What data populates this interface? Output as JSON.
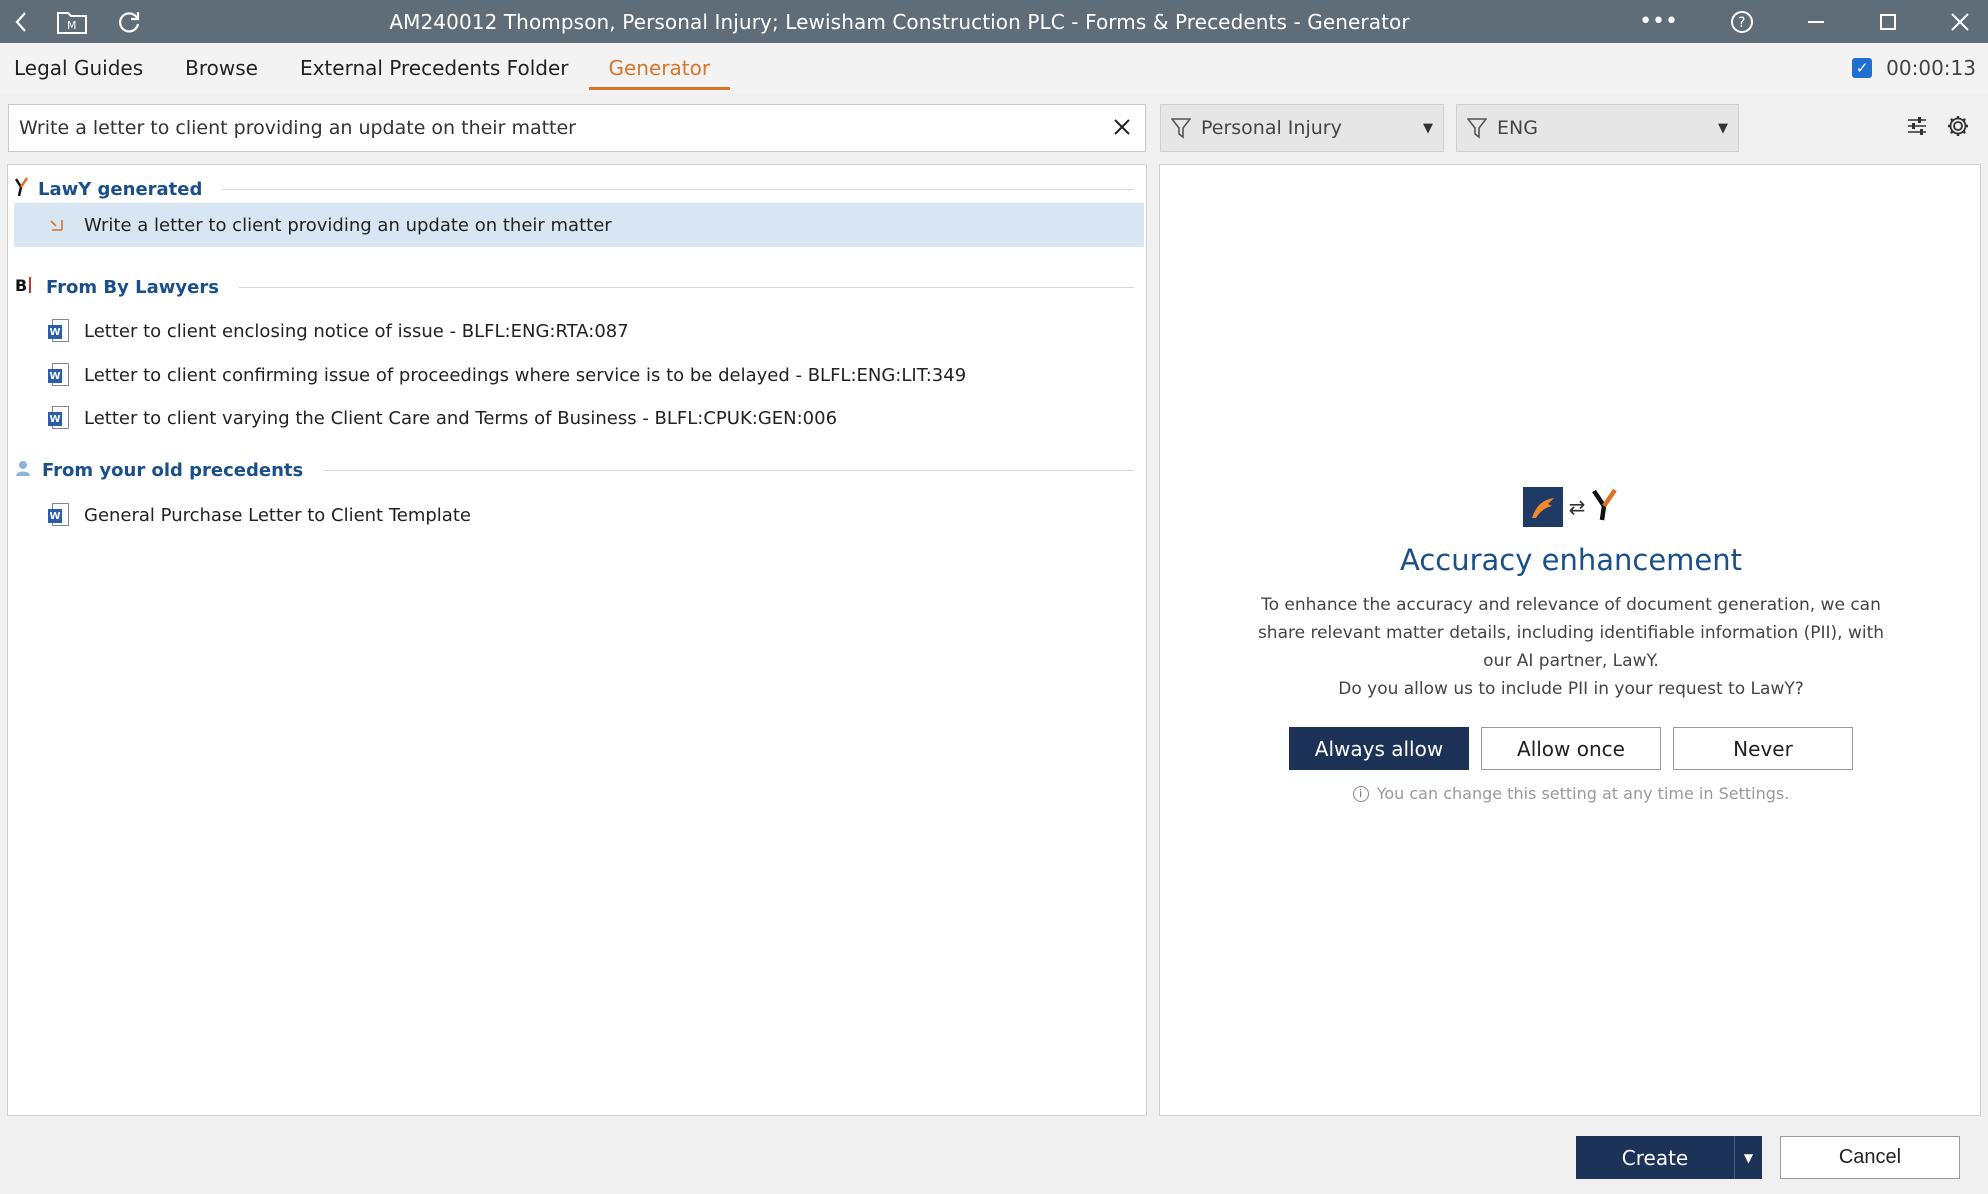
{
  "window": {
    "title": "AM240012 Thompson, Personal Injury; Lewisham Construction PLC - Forms & Precedents - Generator",
    "icons": [
      "back-icon",
      "matter-folder-icon",
      "refresh-icon",
      "more-icon",
      "help-icon",
      "minimize-icon",
      "maximize-icon",
      "close-icon"
    ]
  },
  "tabs": [
    {
      "label": "Legal Guides",
      "active": false
    },
    {
      "label": "Browse",
      "active": false
    },
    {
      "label": "External Precedents Folder",
      "active": false
    },
    {
      "label": "Generator",
      "active": true
    }
  ],
  "timer": {
    "value": "00:00:13",
    "checked": true
  },
  "search": {
    "value": "Write a letter to client providing an update on their matter"
  },
  "filters": [
    {
      "label": "Personal Injury"
    },
    {
      "label": "ENG"
    }
  ],
  "results": {
    "lawy": {
      "heading": "LawY generated",
      "items": [
        {
          "label": "Write a letter to client providing an update on their matter",
          "selected": true
        }
      ]
    },
    "bylawyers": {
      "heading": "From By Lawyers",
      "items": [
        {
          "label": "Letter to client enclosing notice of issue - BLFL:ENG:RTA:087"
        },
        {
          "label": "Letter to client confirming issue of proceedings where service is to be delayed - BLFL:ENG:LIT:349"
        },
        {
          "label": "Letter to client varying the Client Care and Terms of Business - BLFL:CPUK:GEN:006"
        }
      ]
    },
    "old": {
      "heading": "From your old precedents",
      "items": [
        {
          "label": "General Purchase Letter to Client Template"
        }
      ]
    }
  },
  "enhancement": {
    "title": "Accuracy enhancement",
    "description": "To enhance the accuracy and relevance of document generation, we can share relevant matter details, including identifiable information (PII), with our AI partner, LawY.",
    "question": "Do you allow us to include PII in your request to LawY?",
    "buttons": {
      "always": "Always allow",
      "once": "Allow once",
      "never": "Never"
    },
    "hint": "You can change this setting at any time in Settings."
  },
  "footer": {
    "create": "Create",
    "cancel": "Cancel"
  },
  "colors": {
    "accent": "#d8752a",
    "primary": "#1c3357",
    "heading": "#1a4f8a",
    "selected": "#d8e6f3"
  }
}
